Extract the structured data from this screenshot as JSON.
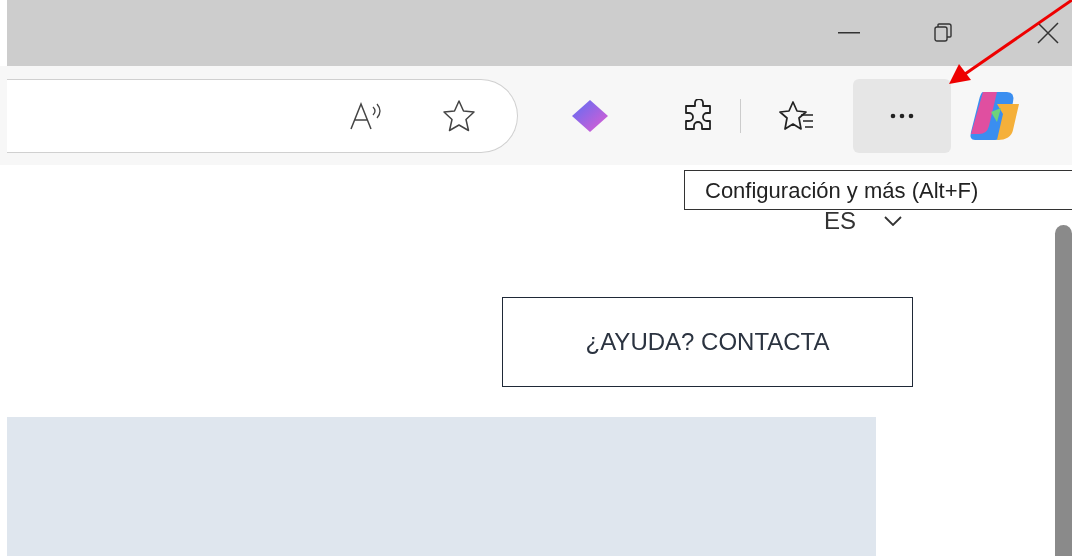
{
  "browser": {
    "more_button": {
      "highlighted": true
    },
    "tooltip": "Configuración y más (Alt+F)"
  },
  "page": {
    "language": "ES",
    "help_button": "¿AYUDA? CONTACTA"
  }
}
